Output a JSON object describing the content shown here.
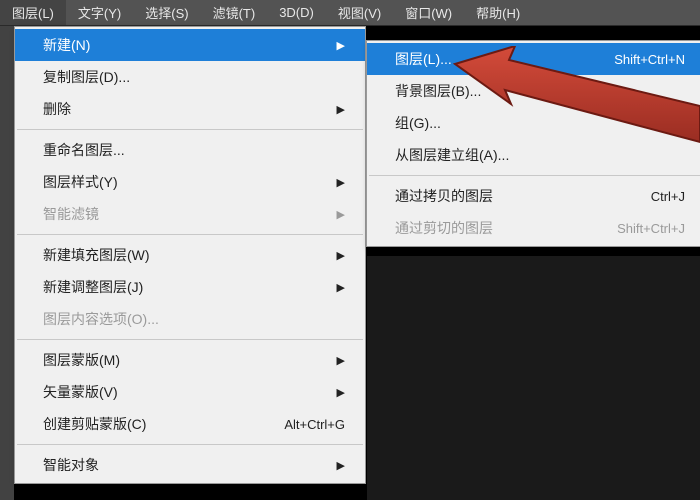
{
  "menubar": {
    "items": [
      {
        "label": "图层(L)"
      },
      {
        "label": "文字(Y)"
      },
      {
        "label": "选择(S)"
      },
      {
        "label": "滤镜(T)"
      },
      {
        "label": "3D(D)"
      },
      {
        "label": "视图(V)"
      },
      {
        "label": "窗口(W)"
      },
      {
        "label": "帮助(H)"
      }
    ]
  },
  "layer_menu": {
    "new": "新建(N)",
    "duplicate_layer": "复制图层(D)...",
    "delete": "删除",
    "rename_layer": "重命名图层...",
    "layer_style": "图层样式(Y)",
    "smart_filter": "智能滤镜",
    "new_fill_layer": "新建填充图层(W)",
    "new_adjustment_layer": "新建调整图层(J)",
    "layer_content_options": "图层内容选项(O)...",
    "layer_mask": "图层蒙版(M)",
    "vector_mask": "矢量蒙版(V)",
    "create_clipping_mask": "创建剪贴蒙版(C)",
    "create_clipping_mask_shortcut": "Alt+Ctrl+G",
    "smart_object": "智能对象"
  },
  "new_submenu": {
    "layer": "图层(L)...",
    "layer_shortcut": "Shift+Ctrl+N",
    "background_layer": "背景图层(B)...",
    "group": "组(G)...",
    "group_from_layers": "从图层建立组(A)...",
    "layer_via_copy": "通过拷贝的图层",
    "layer_via_copy_shortcut": "Ctrl+J",
    "layer_via_cut": "通过剪切的图层",
    "layer_via_cut_shortcut": "Shift+Ctrl+J"
  }
}
